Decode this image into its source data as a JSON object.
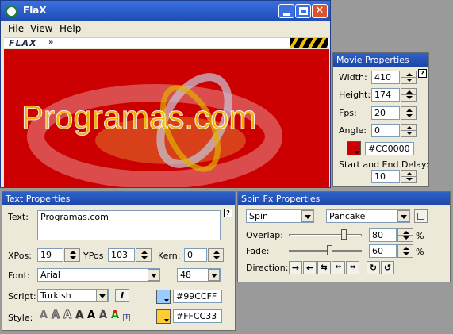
{
  "app": {
    "title": "FlaX",
    "logo_text": "FLAX",
    "canvas_logo_text": "Programas.com"
  },
  "menu": [
    {
      "label": "File"
    },
    {
      "label": "View"
    },
    {
      "label": "Help"
    }
  ],
  "movie_properties": {
    "title": "Movie Properties",
    "width_label": "Width:",
    "width": "410",
    "height_label": "Height:",
    "height": "174",
    "fps_label": "Fps:",
    "fps": "20",
    "angle_label": "Angle:",
    "angle": "0",
    "color_value": "#CC0000",
    "color": "#CC0000",
    "delay_label": "Start and End Delay:",
    "delay": "10"
  },
  "text_properties": {
    "title": "Text Properties",
    "text_label": "Text:",
    "text": "Programas.com",
    "xpos_label": "XPos:",
    "xpos": "19",
    "ypos_label": "YPos",
    "ypos": "103",
    "kern_label": "Kern:",
    "kern": "0",
    "font_label": "Font:",
    "font": "Arial",
    "font_size": "48",
    "script_label": "Script:",
    "script": "Turkish",
    "italic_label": "I",
    "style_label": "Style:",
    "color1": "#99CCFF",
    "color2": "#FFCC33",
    "styles": [
      "A",
      "A",
      "A",
      "A",
      "A",
      "A",
      "A"
    ]
  },
  "spin_fx": {
    "title": "Spin Fx Properties",
    "effect": "Spin",
    "preset": "Pancake",
    "overlap_label": "Overlap:",
    "overlap": "80",
    "overlap_level": 0.8,
    "fade_label": "Fade:",
    "fade": "60",
    "fade_level": 0.6,
    "percent": "%",
    "direction_label": "Direction:"
  }
}
